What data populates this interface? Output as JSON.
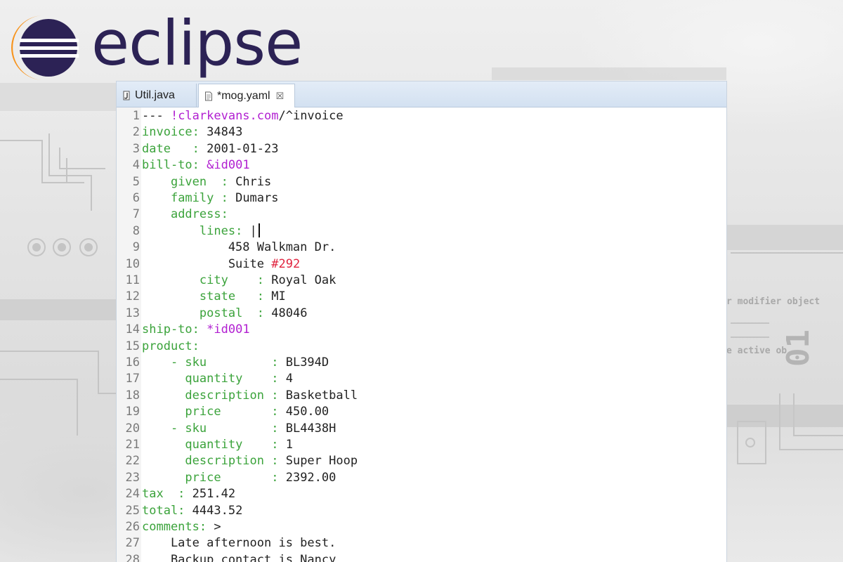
{
  "logo": {
    "wordmark": "eclipse",
    "mark_icon": "eclipse-orb-icon",
    "colors": {
      "orange": "#f7941e",
      "navy": "#2c2255"
    }
  },
  "background": {
    "labels": [
      "r modifier object",
      "e active ob",
      "01"
    ]
  },
  "tabs": [
    {
      "label": "Util.java",
      "icon": "java-file-icon",
      "active": false
    },
    {
      "label": "*mog.yaml",
      "icon": "text-file-icon",
      "active": true,
      "close_glyph": "☒"
    }
  ],
  "colors": {
    "key": "#3ba33b",
    "anchor": "#b11fd1",
    "comment": "#e0243f",
    "text": "#222222"
  },
  "lines": [
    {
      "n": "1",
      "parts": [
        [
          "t",
          "--- "
        ],
        [
          "a",
          "!clarkevans.com"
        ],
        [
          "t",
          "/^invoice"
        ]
      ]
    },
    {
      "n": "2",
      "parts": [
        [
          "k",
          "invoice:"
        ],
        [
          "v",
          " 34843"
        ]
      ]
    },
    {
      "n": "3",
      "parts": [
        [
          "k",
          "date   :"
        ],
        [
          "v",
          " 2001-01-23"
        ]
      ]
    },
    {
      "n": "4",
      "parts": [
        [
          "k",
          "bill-to:"
        ],
        [
          "t",
          " "
        ],
        [
          "a",
          "&id001"
        ]
      ]
    },
    {
      "n": "5",
      "parts": [
        [
          "t",
          "    "
        ],
        [
          "k",
          "given  :"
        ],
        [
          "v",
          " Chris"
        ]
      ]
    },
    {
      "n": "6",
      "parts": [
        [
          "t",
          "    "
        ],
        [
          "k",
          "family :"
        ],
        [
          "v",
          " Dumars"
        ]
      ]
    },
    {
      "n": "7",
      "parts": [
        [
          "t",
          "    "
        ],
        [
          "k",
          "address:"
        ]
      ]
    },
    {
      "n": "8",
      "parts": [
        [
          "t",
          "        "
        ],
        [
          "k",
          "lines:"
        ],
        [
          "v",
          " |"
        ]
      ]
    },
    {
      "n": "9",
      "parts": [
        [
          "t",
          "            458 Walkman Dr."
        ]
      ]
    },
    {
      "n": "10",
      "parts": [
        [
          "t",
          "            Suite "
        ],
        [
          "c",
          "#292"
        ]
      ]
    },
    {
      "n": "11",
      "parts": [
        [
          "t",
          "        "
        ],
        [
          "k",
          "city    :"
        ],
        [
          "v",
          " Royal Oak"
        ]
      ]
    },
    {
      "n": "12",
      "parts": [
        [
          "t",
          "        "
        ],
        [
          "k",
          "state   :"
        ],
        [
          "v",
          " MI"
        ]
      ]
    },
    {
      "n": "13",
      "parts": [
        [
          "t",
          "        "
        ],
        [
          "k",
          "postal  :"
        ],
        [
          "v",
          " 48046"
        ]
      ]
    },
    {
      "n": "14",
      "parts": [
        [
          "k",
          "ship-to:"
        ],
        [
          "t",
          " "
        ],
        [
          "a",
          "*id001"
        ]
      ]
    },
    {
      "n": "15",
      "parts": [
        [
          "k",
          "product:"
        ]
      ]
    },
    {
      "n": "16",
      "parts": [
        [
          "t",
          "    "
        ],
        [
          "k",
          "- sku         :"
        ],
        [
          "v",
          " BL394D"
        ]
      ]
    },
    {
      "n": "17",
      "parts": [
        [
          "t",
          "      "
        ],
        [
          "k",
          "quantity    :"
        ],
        [
          "v",
          " 4"
        ]
      ]
    },
    {
      "n": "18",
      "parts": [
        [
          "t",
          "      "
        ],
        [
          "k",
          "description :"
        ],
        [
          "v",
          " Basketball"
        ]
      ]
    },
    {
      "n": "19",
      "parts": [
        [
          "t",
          "      "
        ],
        [
          "k",
          "price       :"
        ],
        [
          "v",
          " 450.00"
        ]
      ]
    },
    {
      "n": "20",
      "parts": [
        [
          "t",
          "    "
        ],
        [
          "k",
          "- sku         :"
        ],
        [
          "v",
          " BL4438H"
        ]
      ]
    },
    {
      "n": "21",
      "parts": [
        [
          "t",
          "      "
        ],
        [
          "k",
          "quantity    :"
        ],
        [
          "v",
          " 1"
        ]
      ]
    },
    {
      "n": "22",
      "parts": [
        [
          "t",
          "      "
        ],
        [
          "k",
          "description :"
        ],
        [
          "v",
          " Super Hoop"
        ]
      ]
    },
    {
      "n": "23",
      "parts": [
        [
          "t",
          "      "
        ],
        [
          "k",
          "price       :"
        ],
        [
          "v",
          " 2392.00"
        ]
      ]
    },
    {
      "n": "24",
      "parts": [
        [
          "k",
          "tax  :"
        ],
        [
          "v",
          " 251.42"
        ]
      ]
    },
    {
      "n": "25",
      "parts": [
        [
          "k",
          "total:"
        ],
        [
          "v",
          " 4443.52"
        ]
      ]
    },
    {
      "n": "26",
      "parts": [
        [
          "k",
          "comments:"
        ],
        [
          "v",
          " >"
        ]
      ]
    },
    {
      "n": "27",
      "parts": [
        [
          "t",
          "    Late afternoon is best."
        ]
      ]
    },
    {
      "n": "28",
      "parts": [
        [
          "t",
          "    Backup contact is Nancy"
        ]
      ]
    }
  ]
}
